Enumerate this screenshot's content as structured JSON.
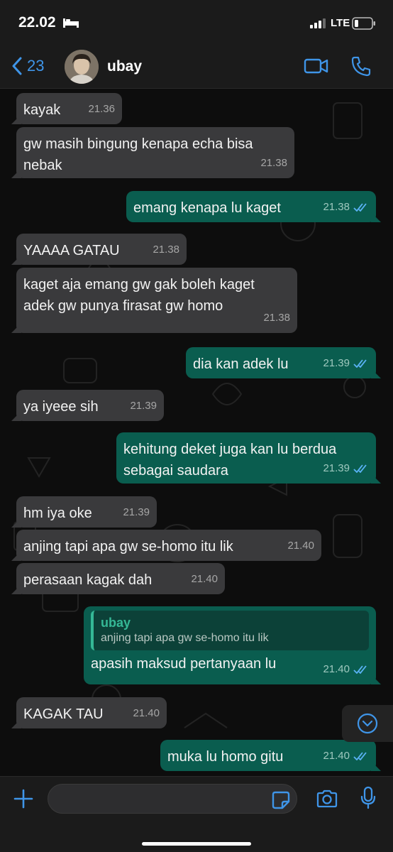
{
  "status_bar": {
    "time": "22.02",
    "network": "LTE"
  },
  "header": {
    "back_count": "23",
    "contact_name": "ubay"
  },
  "messages": [
    {
      "text": "kayak",
      "time": "21.36"
    },
    {
      "text": "gw masih bingung kenapa echa bisa nebak",
      "time": "21.38"
    },
    {
      "text": "emang kenapa lu kaget",
      "time": "21.38"
    },
    {
      "text": "YAAAA GATAU",
      "time": "21.38"
    },
    {
      "text": "kaget aja emang gw gak boleh kaget adek gw punya firasat gw homo",
      "time": "21.38"
    },
    {
      "text": "dia kan adek lu",
      "time": "21.39"
    },
    {
      "text": "ya iyeee sih",
      "time": "21.39"
    },
    {
      "text": "kehitung deket juga kan lu berdua sebagai saudara",
      "time": "21.39"
    },
    {
      "text": "hm iya oke",
      "time": "21.39"
    },
    {
      "text": "anjing tapi apa gw se-homo itu lik",
      "time": "21.40"
    },
    {
      "text": "perasaan kagak dah",
      "time": "21.40"
    },
    {
      "text": "apasih maksud pertanyaan lu",
      "time": "21.40",
      "quote_name": "ubay",
      "quote_text": "anjing tapi apa gw se-homo itu lik"
    },
    {
      "text": "KAGAK TAU",
      "time": "21.40"
    },
    {
      "text": "muka lu homo gitu",
      "time": "21.40"
    }
  ],
  "composer": {
    "placeholder": ""
  },
  "colors": {
    "incoming_bubble": "#3a3a3c",
    "outgoing_bubble": "#0a5d4f",
    "accent": "#3f95e8",
    "quote_accent": "#35b896"
  }
}
